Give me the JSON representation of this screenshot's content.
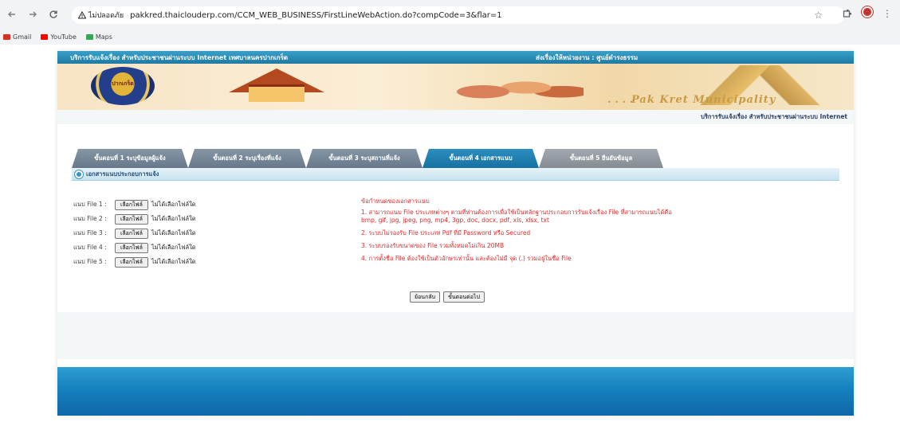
{
  "browser": {
    "security_label": "ไม่ปลอดภัย",
    "url": "pakkred.thaiclouderp.com/CCM_WEB_BUSINESS/FirstLineWebAction.do?compCode=3&flar=1",
    "bookmarks": [
      {
        "label": "Gmail",
        "color": "#d93025"
      },
      {
        "label": "YouTube",
        "color": "#ff0000"
      },
      {
        "label": "Maps",
        "color": "#34a853"
      }
    ]
  },
  "site": {
    "top_left": "บริการรับแจ้งเรื่อง สำหรับประชาชนผ่านระบบ Internet เทศบาลนครปากเกร็ด",
    "top_right": "ส่งเรื่องให้หน่วยงาน : ศูนย์ดำรงธรรม",
    "brand": "Pak Kret Municipality",
    "brand_prefix": "• • • •",
    "seal_text": "ปากเกร็ด",
    "subtitle": "บริการรับแจ้งเรื่อง สำหรับประชาชนผ่านระบบ Internet"
  },
  "tabs": [
    {
      "label": "ขั้นตอนที่ 1 ระบุข้อมูลผู้แจ้ง",
      "state": "inactive"
    },
    {
      "label": "ขั้นตอนที่ 2 ระบุเรื่องที่แจ้ง",
      "state": "inactive"
    },
    {
      "label": "ขั้นตอนที่ 3 ระบุสถานที่แจ้ง",
      "state": "inactive"
    },
    {
      "label": "ขั้นตอนที่ 4 เอกสารแนบ",
      "state": "active"
    },
    {
      "label": "ขั้นตอนที่ 5 ยืนยันข้อมูล",
      "state": "disabled"
    }
  ],
  "section_title": "เอกสารแนบประกอบการแจ้ง",
  "files": [
    {
      "label": "แนบ File 1 :",
      "button": "เลือกไฟล์",
      "status": "ไม่ได้เลือกไฟล์ใด"
    },
    {
      "label": "แนบ File 2 :",
      "button": "เลือกไฟล์",
      "status": "ไม่ได้เลือกไฟล์ใด"
    },
    {
      "label": "แนบ File 3 :",
      "button": "เลือกไฟล์",
      "status": "ไม่ได้เลือกไฟล์ใด"
    },
    {
      "label": "แนบ File 4 :",
      "button": "เลือกไฟล์",
      "status": "ไม่ได้เลือกไฟล์ใด"
    },
    {
      "label": "แนบ File 5 :",
      "button": "เลือกไฟล์",
      "status": "ไม่ได้เลือกไฟล์ใด"
    }
  ],
  "notes": {
    "heading": "ข้อกำหนดของเอกสารแนบ",
    "items": [
      "1. สามารถแนบ File ประเภทต่างๆ ตามที่ท่านต้องการเพื่อใช้เป็นหลักฐานประกอบการรับแจ้งเรื่อง File ที่สามารถแนบได้คือ bmp, gif, jpg, jpeg, png, mp4, 3gp, doc, docx, pdf, xls, xlsx, txt",
      "2. ระบบไม่รองรับ File ประเภท Pdf ที่มี Password หรือ Secured",
      "3. ระบบรองรับขนาดของ File รวมทั้งหมดไม่เกิน 20MB",
      "4. การตั้งชื่อ File ต้องใช้เป็นตัวอักษรเท่านั้น และต้องไม่มี จุด (.) รวมอยู่ในชื่อ File"
    ]
  },
  "actions": {
    "back": "ย้อนกลับ",
    "next": "ขั้นตอนต่อไป"
  },
  "colors": {
    "header_blue": "#1d7aa4",
    "active_tab": "#1771a0",
    "warning_red": "#e02b2b"
  }
}
